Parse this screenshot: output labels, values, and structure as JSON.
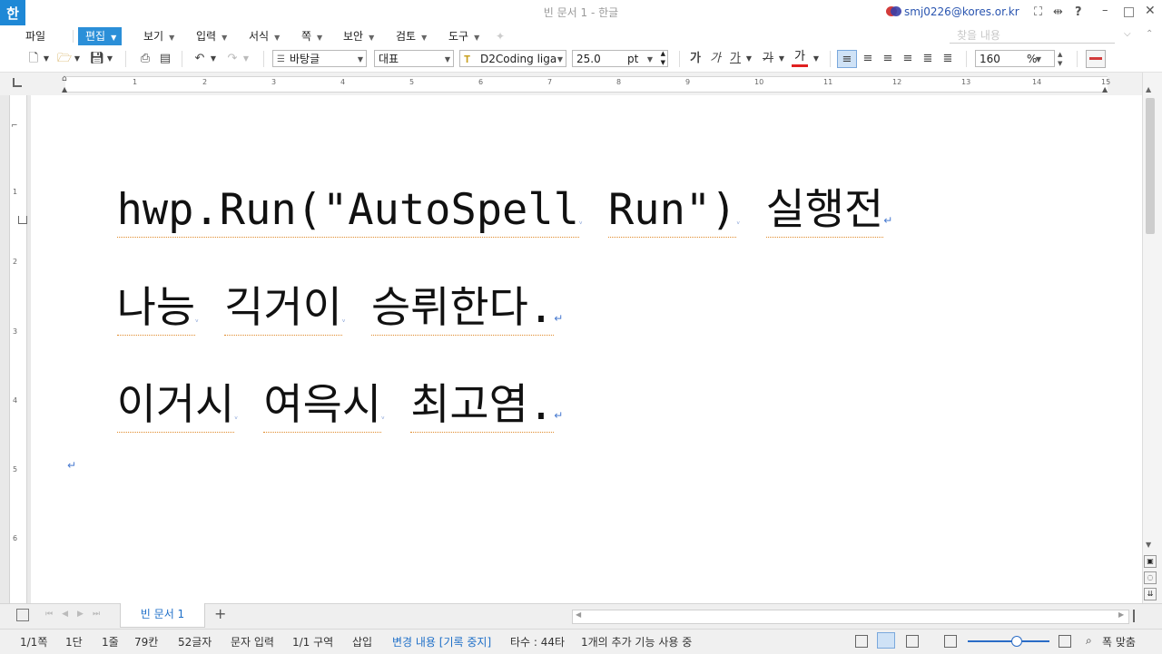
{
  "titlebar": {
    "app_icon": "한",
    "title": "빈 문서 1 - 한글",
    "user_email": "smj0226@kores.or.kr",
    "icons": [
      "fullscreen-icon",
      "width-fit-icon",
      "help-icon",
      "minimize-icon",
      "restore-icon",
      "close-icon"
    ],
    "help_glyph": "?"
  },
  "menubar": {
    "items": [
      {
        "label": "파일"
      },
      {
        "label": "편집"
      },
      {
        "label": "보기"
      },
      {
        "label": "입력"
      },
      {
        "label": "서식"
      },
      {
        "label": "쪽"
      },
      {
        "label": "보안"
      },
      {
        "label": "검토"
      },
      {
        "label": "도구"
      }
    ],
    "search_placeholder": "찾을 내용"
  },
  "toolbar": {
    "style_value": "바탕글",
    "language_value": "대표",
    "font_value": "D2Coding liga",
    "size_value": "25.0",
    "size_unit": "pt",
    "char_buttons": [
      "가",
      "가",
      "가",
      "가",
      "가"
    ],
    "zoom_value": "160",
    "zoom_unit": "%"
  },
  "ruler": {
    "numbers": [
      "1",
      "2",
      "3",
      "4",
      "5",
      "6",
      "7",
      "8",
      "9",
      "10",
      "11",
      "12",
      "13",
      "14",
      "15"
    ],
    "vnumbers": [
      "1",
      "2",
      "3",
      "4",
      "5",
      "6"
    ]
  },
  "document": {
    "lines": [
      {
        "words": [
          "hwp.Run(\"AutoSpell",
          "Run\")",
          "실행전"
        ]
      },
      {
        "words": [
          "나능",
          "긱거이",
          "승뤼한다."
        ]
      },
      {
        "words": [
          "이거시",
          "여윽시",
          "최고염."
        ]
      }
    ],
    "paragraph_mark": "↵"
  },
  "tabs": {
    "doc_tab": "빈 문서 1",
    "add_tab": "+"
  },
  "status": {
    "page": "1/1쪽",
    "column": "1단",
    "line": "1줄",
    "col": "79칸",
    "chars": "52글자",
    "mode": "문자 입력",
    "section": "1/1 구역",
    "insert": "삽입",
    "change": "변경 내용 [기록 중지]",
    "typing": "타수 : 44타",
    "addon": "1개의 추가 기능 사용 중",
    "fit": "폭 맞춤"
  },
  "colors": {
    "accent": "#2b8fd8",
    "spell_underline": "#e08a2a",
    "paragraph_mark": "#4a7bd0"
  }
}
